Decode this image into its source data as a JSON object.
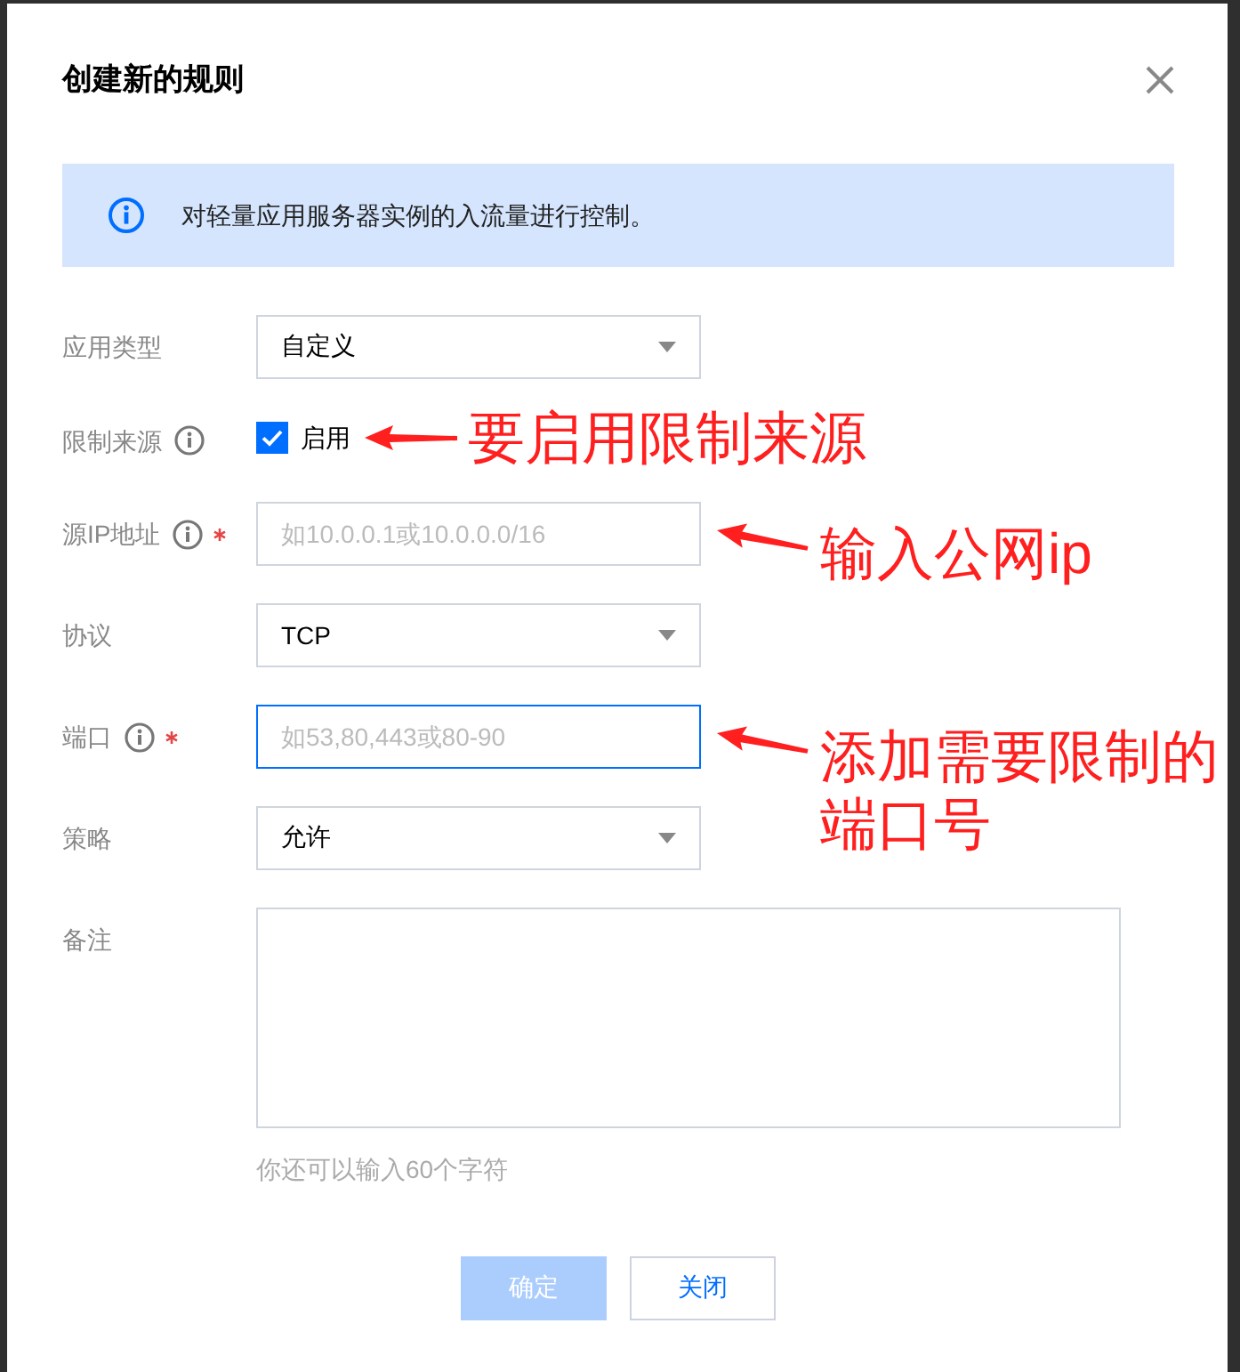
{
  "dialog": {
    "title": "创建新的规则"
  },
  "notice": {
    "text": "对轻量应用服务器实例的入流量进行控制。"
  },
  "form": {
    "fields": [
      {
        "kind": "select",
        "label": "应用类型",
        "info": false,
        "required": false,
        "focused": false,
        "value": "自定义"
      },
      {
        "kind": "checkbox",
        "label": "限制来源",
        "info": true,
        "required": false,
        "checked": true,
        "option": "启用",
        "annotation": "要启用限制来源"
      },
      {
        "kind": "input",
        "label": "源IP地址",
        "info": true,
        "required": true,
        "focused": false,
        "placeholder": "如10.0.0.1或10.0.0.0/16",
        "annotation": "输入公网ip"
      },
      {
        "kind": "select",
        "label": "协议",
        "info": false,
        "required": false,
        "focused": false,
        "value": "TCP"
      },
      {
        "kind": "input",
        "label": "端口",
        "info": true,
        "required": true,
        "focused": true,
        "placeholder": "如53,80,443或80-90",
        "annotation": "添加需要限制的端口号"
      },
      {
        "kind": "select",
        "label": "策略",
        "info": false,
        "required": false,
        "focused": false,
        "value": "允许"
      },
      {
        "kind": "textarea",
        "label": "备注",
        "info": false,
        "required": false,
        "focused": false,
        "hint": "你还可以输入60个字符"
      }
    ]
  },
  "buttons": [
    {
      "label": "确定",
      "kind": "primary",
      "disabled": true
    },
    {
      "label": "关闭",
      "kind": "secondary",
      "disabled": false
    }
  ]
}
